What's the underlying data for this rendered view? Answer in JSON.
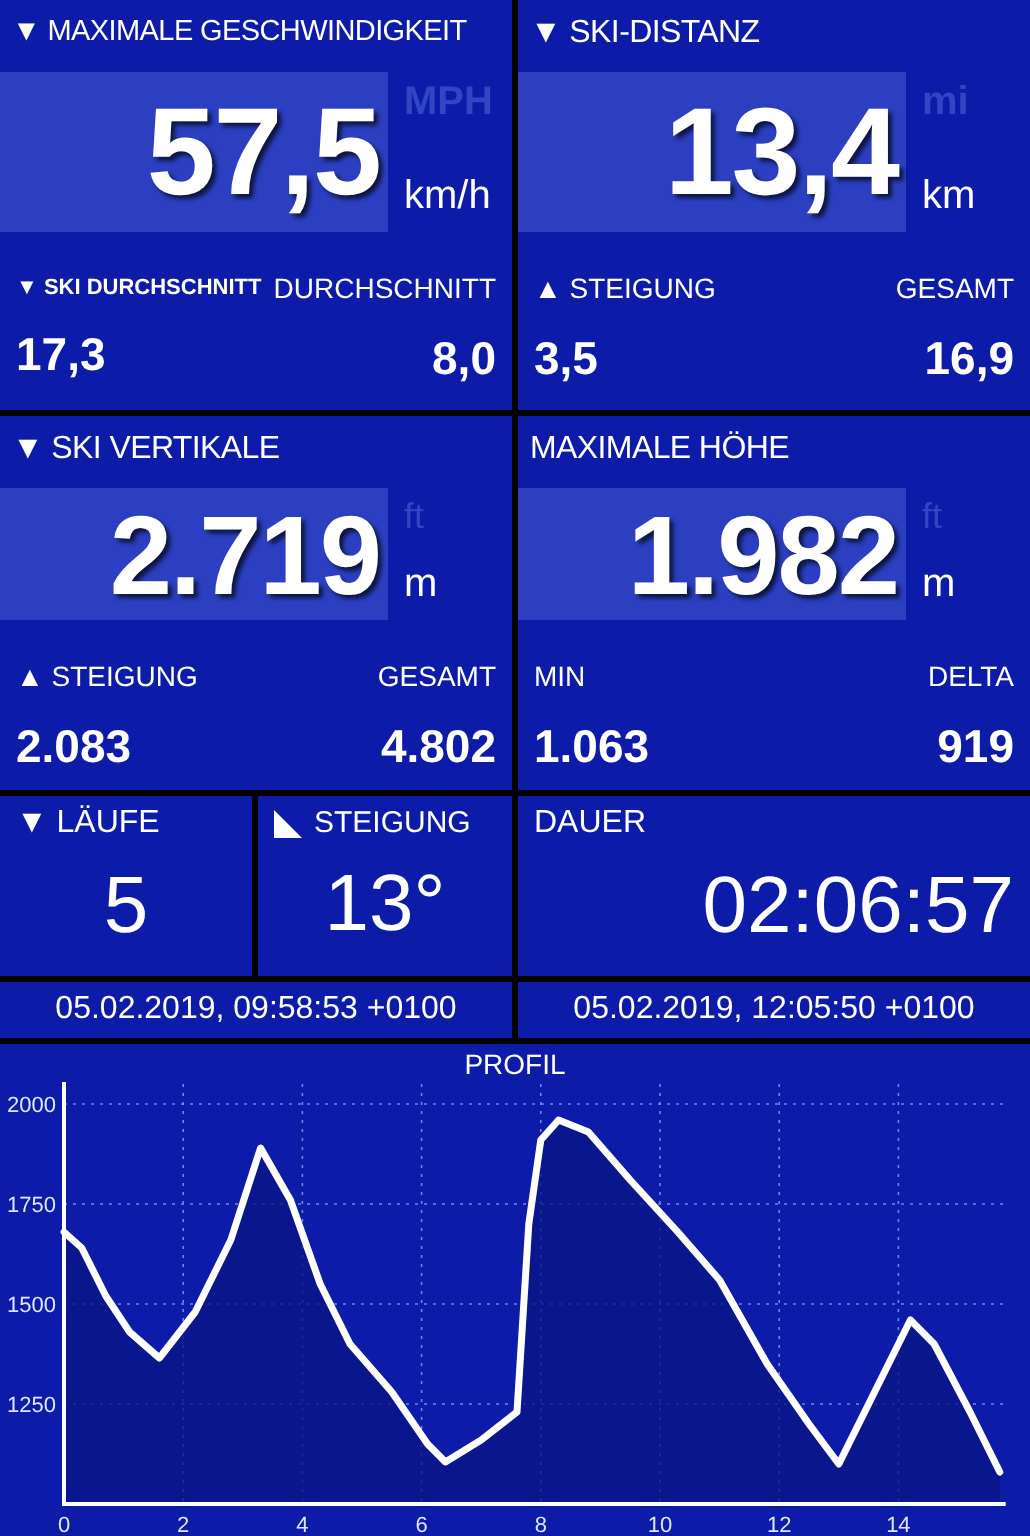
{
  "cards": [
    {
      "title": "▼ MAXIMALE GESCHWINDIGKEIT",
      "value": "57,5",
      "units": [
        {
          "label": "MPH",
          "selected": false
        },
        {
          "label": "km/h",
          "selected": true
        }
      ],
      "stats": [
        {
          "label": "▼ SKI DURCHSCHNITT",
          "value": "17,3"
        },
        {
          "label": "DURCHSCHNITT",
          "value": "8,0"
        }
      ]
    },
    {
      "title": "▼ SKI-DISTANZ",
      "value": "13,4",
      "units": [
        {
          "label": "mi",
          "selected": false
        },
        {
          "label": "km",
          "selected": true
        }
      ],
      "stats": [
        {
          "label": "▲ STEIGUNG",
          "value": "3,5"
        },
        {
          "label": "GESAMT",
          "value": "16,9"
        }
      ]
    },
    {
      "title": "▼ SKI VERTIKALE",
      "value": "2.719",
      "units": [
        {
          "label": "ft",
          "selected": false
        },
        {
          "label": "m",
          "selected": true
        }
      ],
      "stats": [
        {
          "label": "▲ STEIGUNG",
          "value": "2.083"
        },
        {
          "label": "GESAMT",
          "value": "4.802"
        }
      ]
    },
    {
      "title": "MAXIMALE HÖHE",
      "value": "1.982",
      "units": [
        {
          "label": "ft",
          "selected": false
        },
        {
          "label": "m",
          "selected": true
        }
      ],
      "stats": [
        {
          "label": "MIN",
          "value": "1.063"
        },
        {
          "label": "DELTA",
          "value": "919"
        }
      ]
    }
  ],
  "small_tiles": [
    {
      "kind": "runs",
      "title": "▼ LÄUFE",
      "value": "5"
    },
    {
      "kind": "slope",
      "title": "STEIGUNG",
      "value": "13°"
    },
    {
      "kind": "duration",
      "title": "DAUER",
      "value": "02:06:57"
    }
  ],
  "start_time": "05.02.2019, 09:58:53 +0100",
  "end_time": "05.02.2019, 12:05:50 +0100",
  "profile": {
    "title": "PROFIL",
    "chart_data": {
      "type": "area",
      "x": [
        0,
        0.3,
        0.7,
        1.1,
        1.6,
        2.2,
        2.8,
        3.3,
        3.8,
        4.3,
        4.8,
        5.5,
        6.1,
        6.4,
        7,
        7.6,
        7.8,
        8.0,
        8.3,
        8.8,
        9.5,
        10.3,
        11.0,
        11.8,
        12.5,
        13.0,
        13.6,
        14.2,
        14.6,
        15.2,
        15.7
      ],
      "series": [
        {
          "color": "#ffffff",
          "values": [
            1680,
            1640,
            1520,
            1430,
            1365,
            1480,
            1660,
            1890,
            1760,
            1550,
            1400,
            1280,
            1150,
            1105,
            1160,
            1230,
            1700,
            1910,
            1960,
            1930,
            1810,
            1680,
            1560,
            1350,
            1200,
            1100,
            1280,
            1460,
            1400,
            1230,
            1080
          ]
        }
      ],
      "xlim": [
        0,
        15.8
      ],
      "ylim": [
        1000,
        2050
      ],
      "xticks": [
        0,
        2,
        4,
        6,
        8,
        10,
        12,
        14
      ],
      "yticks": [
        1250,
        1500,
        1750,
        2000
      ],
      "grid": true
    }
  }
}
